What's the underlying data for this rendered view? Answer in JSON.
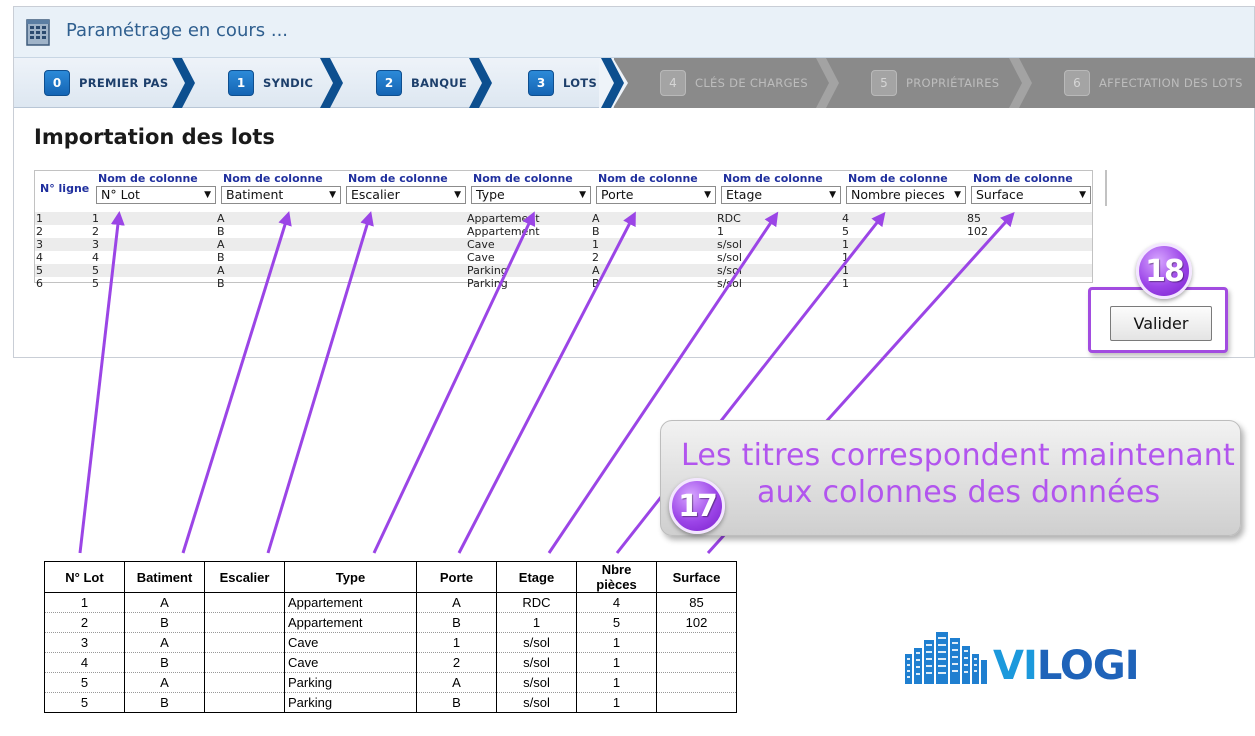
{
  "app": {
    "title": "Paramétrage en cours ..."
  },
  "steps": [
    {
      "number": "0",
      "label": "PREMIER PAS",
      "state": "active"
    },
    {
      "number": "1",
      "label": "SYNDIC",
      "state": "active"
    },
    {
      "number": "2",
      "label": "BANQUE",
      "state": "active"
    },
    {
      "number": "3",
      "label": "LOTS",
      "state": "active"
    },
    {
      "number": "4",
      "label": "CLÉS DE CHARGES",
      "state": "inactive"
    },
    {
      "number": "5",
      "label": "PROPRIÉTAIRES",
      "state": "inactive"
    },
    {
      "number": "6",
      "label": "AFFECTATION DES LOTS",
      "state": "inactive"
    }
  ],
  "page": {
    "title": "Importation des lots"
  },
  "grid": {
    "row_number_header": "N° ligne",
    "column_caption": "Nom de colonne",
    "columns": [
      "N° Lot",
      "Batiment",
      "Escalier",
      "Type",
      "Porte",
      "Etage",
      "Nombre pieces",
      "Surface"
    ],
    "rows": [
      {
        "line": "1",
        "cells": [
          "1",
          "A",
          "",
          "Appartement",
          "A",
          "RDC",
          "4",
          "85"
        ]
      },
      {
        "line": "2",
        "cells": [
          "2",
          "B",
          "",
          "Appartement",
          "B",
          "1",
          "5",
          "102"
        ]
      },
      {
        "line": "3",
        "cells": [
          "3",
          "A",
          "",
          "Cave",
          "1",
          "s/sol",
          "1",
          ""
        ]
      },
      {
        "line": "4",
        "cells": [
          "4",
          "B",
          "",
          "Cave",
          "2",
          "s/sol",
          "1",
          ""
        ]
      },
      {
        "line": "5",
        "cells": [
          "5",
          "A",
          "",
          "Parking",
          "A",
          "s/sol",
          "1",
          ""
        ]
      },
      {
        "line": "6",
        "cells": [
          "5",
          "B",
          "",
          "Parking",
          "B",
          "s/sol",
          "1",
          ""
        ]
      }
    ]
  },
  "validate_button": {
    "label": "Valider"
  },
  "badges": {
    "validate": "18",
    "callout": "17"
  },
  "callout": {
    "line1": "Les titres correspondent maintenant",
    "line2": "aux colonnes des données"
  },
  "reference_table": {
    "headers": [
      "N° Lot",
      "Batiment",
      "Escalier",
      "Type",
      "Porte",
      "Etage",
      "Nbre pièces",
      "Surface"
    ],
    "rows": [
      [
        "1",
        "A",
        "",
        "Appartement",
        "A",
        "RDC",
        "4",
        "85"
      ],
      [
        "2",
        "B",
        "",
        "Appartement",
        "B",
        "1",
        "5",
        "102"
      ],
      [
        "3",
        "A",
        "",
        "Cave",
        "1",
        "s/sol",
        "1",
        ""
      ],
      [
        "4",
        "B",
        "",
        "Cave",
        "2",
        "s/sol",
        "1",
        ""
      ],
      [
        "5",
        "A",
        "",
        "Parking",
        "A",
        "s/sol",
        "1",
        ""
      ],
      [
        "5",
        "B",
        "",
        "Parking",
        "B",
        "s/sol",
        "1",
        ""
      ]
    ]
  },
  "logo": {
    "text_vi": "VI",
    "text_logi": "LOGI"
  },
  "colors": {
    "accent_purple": "#a24ce0",
    "step_active": "#1565b4",
    "step_inactive_bg": "#8a8a8a",
    "grid_header_text": "#1f2f9e",
    "title_text": "#2f5f8f"
  }
}
